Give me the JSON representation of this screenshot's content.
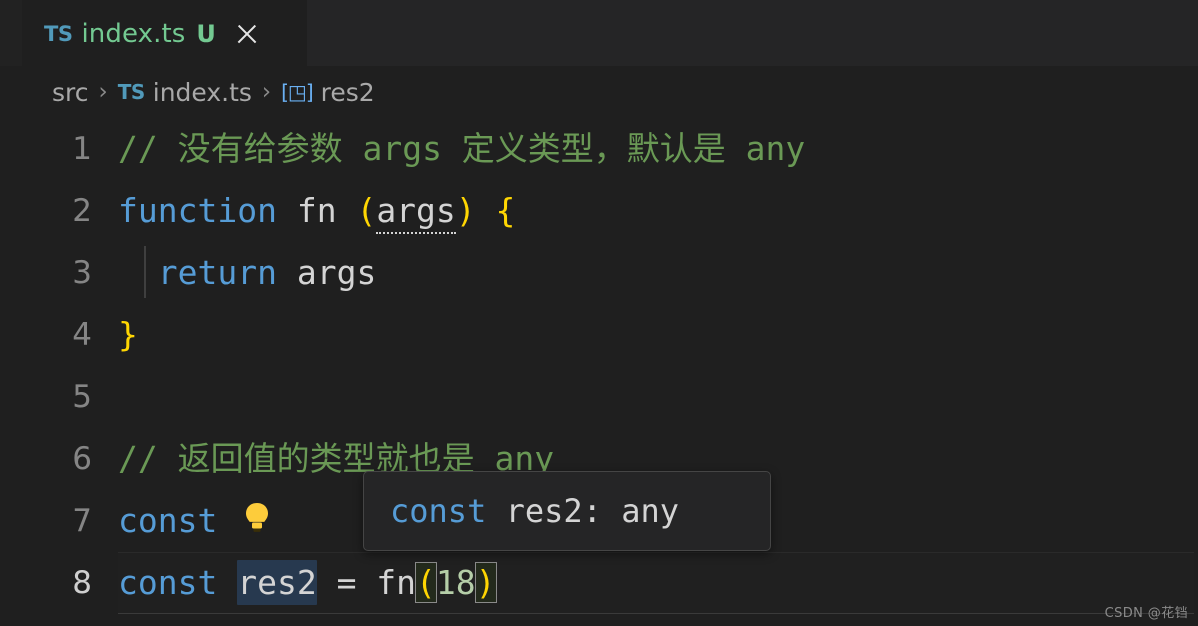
{
  "window": {
    "background_color": "#1f1f1f",
    "tabbar_color": "#252526"
  },
  "tab": {
    "file_type_badge": "TS",
    "label": "index.ts",
    "git_status_badge": "U",
    "close_label": "×",
    "label_color": "#73c991",
    "ts_color": "#519aba"
  },
  "breadcrumb": {
    "folder": "src",
    "separator1": "›",
    "file_type_badge": "TS",
    "file": "index.ts",
    "separator2": "›",
    "symbol_icon": "[◳]",
    "symbol": "res2"
  },
  "editor": {
    "lines": [
      {
        "no": "1",
        "tokens": [
          {
            "text": "// 没有给参数 args 定义类型，默认是 any",
            "cls": "tk-comment"
          }
        ]
      },
      {
        "no": "2",
        "tokens": [
          {
            "text": "function",
            "cls": "tk-keyword"
          },
          {
            "text": " fn ",
            "cls": "tk-ident"
          },
          {
            "text": "(",
            "cls": "tk-yellow"
          },
          {
            "text": "args",
            "cls": "tk-ident squiggle-dots"
          },
          {
            "text": ")",
            "cls": "tk-yellow"
          },
          {
            "text": " ",
            "cls": "tk-plain"
          },
          {
            "text": "{",
            "cls": "tk-yellow"
          }
        ]
      },
      {
        "no": "3",
        "tokens": [
          {
            "text": "  ",
            "cls": "tk-plain"
          },
          {
            "text": "return",
            "cls": "tk-keyword"
          },
          {
            "text": " args",
            "cls": "tk-ident"
          }
        ]
      },
      {
        "no": "4",
        "tokens": [
          {
            "text": "}",
            "cls": "tk-yellow"
          }
        ]
      },
      {
        "no": "5",
        "tokens": [
          {
            "text": "",
            "cls": "tk-plain"
          }
        ]
      },
      {
        "no": "6",
        "tokens": [
          {
            "text": "// 返回值的类型就也是 any",
            "cls": "tk-comment"
          }
        ]
      },
      {
        "no": "7",
        "tokens": [
          {
            "text": "const",
            "cls": "tk-keyword"
          }
        ]
      },
      {
        "no": "8",
        "tokens": [
          {
            "text": "const",
            "cls": "tk-keyword"
          },
          {
            "text": " ",
            "cls": "tk-plain"
          },
          {
            "text": "res2",
            "cls": "tk-ident selection"
          },
          {
            "text": " = fn",
            "cls": "tk-ident"
          },
          {
            "text": "(",
            "cls": "tk-yellow bracket-box"
          },
          {
            "text": "18",
            "cls": "tk-number"
          },
          {
            "text": ")",
            "cls": "tk-yellow bracket-box"
          }
        ]
      }
    ]
  },
  "hover_tooltip": {
    "keyword": "const",
    "space": " ",
    "signature": "res2: any"
  },
  "quick_fix": {
    "icon_name": "lightbulb-icon",
    "color": "#fdcc3b"
  },
  "watermark": {
    "text": "CSDN @花铛"
  }
}
